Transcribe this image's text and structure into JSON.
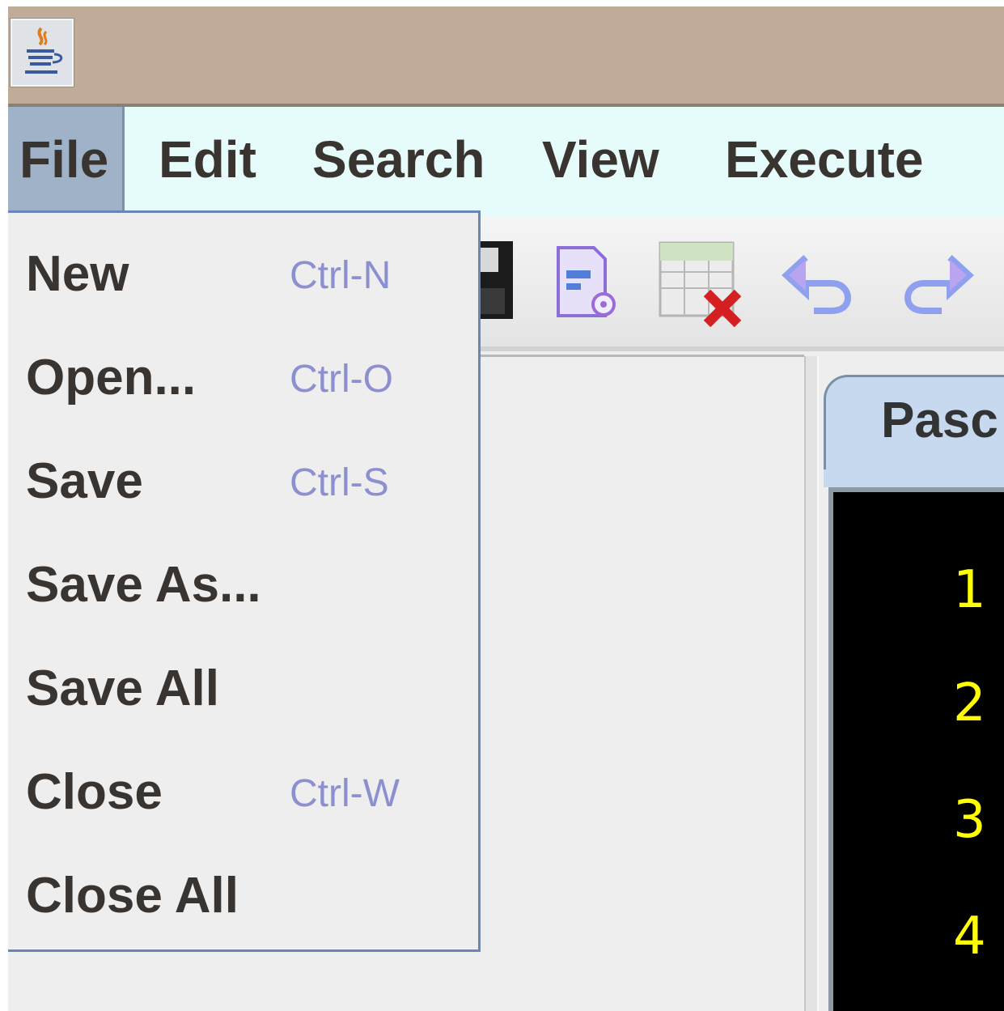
{
  "menubar": {
    "items": [
      {
        "label": "File"
      },
      {
        "label": "Edit"
      },
      {
        "label": "Search"
      },
      {
        "label": "View"
      },
      {
        "label": "Execute"
      }
    ]
  },
  "file_menu": {
    "items": [
      {
        "label": "New",
        "shortcut": "Ctrl-N"
      },
      {
        "label": "Open...",
        "shortcut": "Ctrl-O"
      },
      {
        "label": "Save",
        "shortcut": "Ctrl-S"
      },
      {
        "label": "Save As...",
        "shortcut": ""
      },
      {
        "label": "Save All",
        "shortcut": ""
      },
      {
        "label": "Close",
        "shortcut": "Ctrl-W"
      },
      {
        "label": "Close All",
        "shortcut": ""
      }
    ]
  },
  "toolbar": {
    "icons": [
      "save-icon",
      "document-properties-icon",
      "close-table-icon",
      "undo-icon",
      "redo-icon"
    ]
  },
  "editor": {
    "tab_label": "Pasc",
    "line_numbers": [
      "1",
      "2",
      "3",
      "4"
    ]
  },
  "colors": {
    "titlebar": "#c0ab98",
    "menubar": "#e6fcfb",
    "menu_selected": "#9fb2c8",
    "dropdown_border": "#6a85b7",
    "shortcut_text": "#8c8fd0",
    "editor_bg": "#000000",
    "line_number": "#ffff00"
  }
}
